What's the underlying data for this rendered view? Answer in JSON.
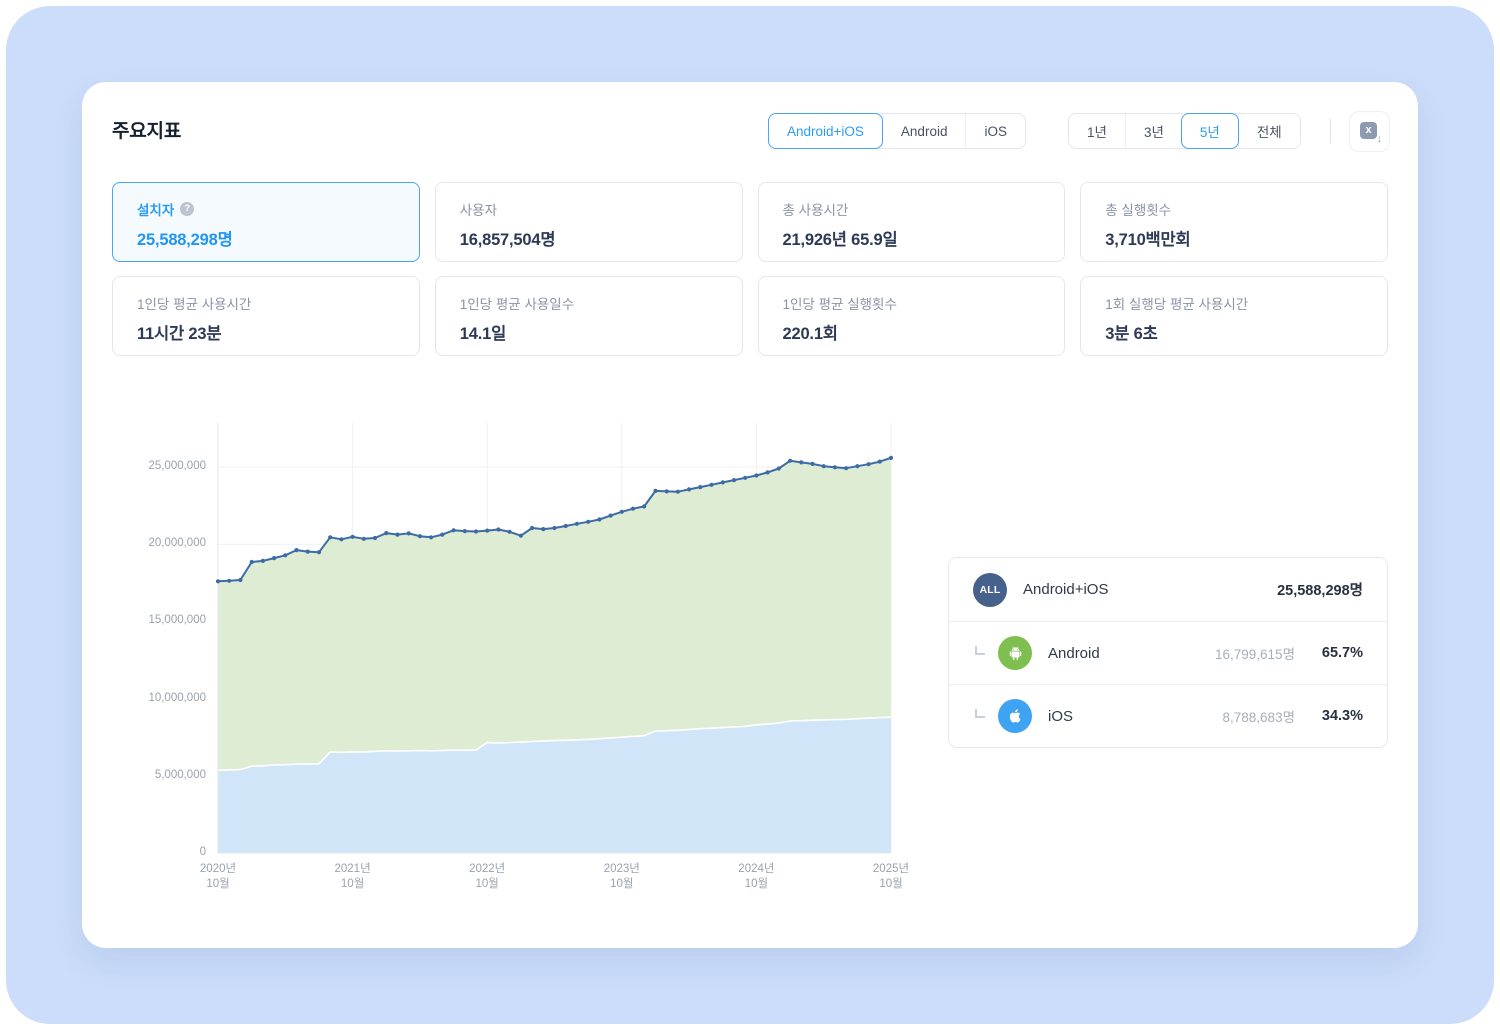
{
  "page": {
    "title": "주요지표"
  },
  "platform_tabs": {
    "items": [
      {
        "label": "Android+iOS",
        "selected": true
      },
      {
        "label": "Android",
        "selected": false
      },
      {
        "label": "iOS",
        "selected": false
      }
    ]
  },
  "range_tabs": {
    "items": [
      {
        "label": "1년",
        "selected": false
      },
      {
        "label": "3년",
        "selected": false
      },
      {
        "label": "5년",
        "selected": true
      },
      {
        "label": "전체",
        "selected": false
      }
    ]
  },
  "export_button": {
    "icon": "excel-download-icon",
    "icon_letter": "x",
    "icon_arrow": "↓"
  },
  "stat_cards": [
    {
      "label": "설치자",
      "value": "25,588,298명",
      "selected": true,
      "has_help_icon": true,
      "help_glyph": "?"
    },
    {
      "label": "사용자",
      "value": "16,857,504명"
    },
    {
      "label": "총 사용시간",
      "value": "21,926년 65.9일"
    },
    {
      "label": "총 실행횟수",
      "value": "3,710백만회"
    },
    {
      "label": "1인당 평균 사용시간",
      "value": "11시간 23분"
    },
    {
      "label": "1인당 평균 사용일수",
      "value": "14.1일"
    },
    {
      "label": "1인당 평균 실행횟수",
      "value": "220.1회"
    },
    {
      "label": "1회 실행당 평균 사용시간",
      "value": "3분 6초"
    }
  ],
  "legend": {
    "rows": [
      {
        "badge": "ALL",
        "name": "Android+iOS",
        "value": "25,588,298명"
      },
      {
        "icon": "android-icon",
        "name": "Android",
        "count": "16,799,615명",
        "percent": "65.7%"
      },
      {
        "icon": "apple-icon",
        "name": "iOS",
        "count": "8,788,683명",
        "percent": "34.3%"
      }
    ]
  },
  "colors": {
    "accent_blue": "#2b9bf3",
    "selected_border": "#49a5f6",
    "total_line": "#3c6ba5",
    "ios_area_fill": "#cde4f7",
    "android_area_fill": "#dbead0",
    "android_icon_green": "#7fbf50",
    "ios_icon_blue": "#3ea3f2",
    "all_badge_navy": "#45618c",
    "page_background": "#cbddfa"
  },
  "chart_data": {
    "type": "area",
    "x_range": [
      "2020-10",
      "2025-10"
    ],
    "granularity": "monthly",
    "points": 61,
    "grid": true,
    "legend_position": "right-panel",
    "ylim": [
      0,
      27000000
    ],
    "y_ticks": [
      {
        "label": "0",
        "value": 0
      },
      {
        "label": "5,000,000",
        "value": 5
      },
      {
        "label": "10,000,000",
        "value": 10
      },
      {
        "label": "15,000,000",
        "value": 15
      },
      {
        "label": "20,000,000",
        "value": 20
      },
      {
        "label": "25,000,000",
        "value": 25
      }
    ],
    "x_ticks": [
      {
        "line1": "2020년",
        "line2": "10월",
        "m": 0
      },
      {
        "line1": "2021년",
        "line2": "10월",
        "m": 12
      },
      {
        "line1": "2022년",
        "line2": "10월",
        "m": 24
      },
      {
        "line1": "2023년",
        "line2": "10월",
        "m": 36
      },
      {
        "line1": "2024년",
        "line2": "10월",
        "m": 48
      },
      {
        "line1": "2025년",
        "line2": "10월",
        "m": 60
      }
    ],
    "series": [
      {
        "name": "iOS",
        "type": "area",
        "color": "#cde4f7",
        "values": [
          5350000,
          5380000,
          5400000,
          5620000,
          5650000,
          5700000,
          5720000,
          5750000,
          5760000,
          5780000,
          6550000,
          6520000,
          6550000,
          6550000,
          6580000,
          6620000,
          6600000,
          6620000,
          6630000,
          6620000,
          6640000,
          6660000,
          6650000,
          6670000,
          7150000,
          7120000,
          7150000,
          7180000,
          7220000,
          7250000,
          7280000,
          7300000,
          7330000,
          7360000,
          7400000,
          7450000,
          7500000,
          7550000,
          7600000,
          7900000,
          7920000,
          7950000,
          8000000,
          8050000,
          8080000,
          8120000,
          8160000,
          8200000,
          8300000,
          8350000,
          8420000,
          8550000,
          8570000,
          8600000,
          8620000,
          8640000,
          8660000,
          8700000,
          8740000,
          8770000,
          8788683
        ]
      },
      {
        "name": "Android",
        "type": "area-stacked",
        "color": "#dbead0",
        "values": [
          12250000,
          12250000,
          12280000,
          13230000,
          13270000,
          13400000,
          13560000,
          13870000,
          13760000,
          13700000,
          13900000,
          13800000,
          13930000,
          13800000,
          13820000,
          14100000,
          14020000,
          14080000,
          13890000,
          13830000,
          13980000,
          14240000,
          14200000,
          14150000,
          13730000,
          13830000,
          13650000,
          13370000,
          13830000,
          13730000,
          13770000,
          13880000,
          13990000,
          14090000,
          14200000,
          14400000,
          14600000,
          14750000,
          14850000,
          15550000,
          15500000,
          15450000,
          15550000,
          15650000,
          15770000,
          15880000,
          15990000,
          16100000,
          16150000,
          16300000,
          16480000,
          16850000,
          16730000,
          16600000,
          16430000,
          16340000,
          16260000,
          16350000,
          16440000,
          16580000,
          16799615
        ]
      },
      {
        "name": "Android+iOS",
        "type": "line",
        "color": "#3c6ba5",
        "markers": true,
        "values": [
          17600000,
          17630000,
          17680000,
          18850000,
          18920000,
          19100000,
          19280000,
          19620000,
          19520000,
          19480000,
          20450000,
          20320000,
          20480000,
          20350000,
          20400000,
          20720000,
          20620000,
          20700000,
          20520000,
          20450000,
          20620000,
          20900000,
          20850000,
          20820000,
          20880000,
          20950000,
          20800000,
          20550000,
          21050000,
          20980000,
          21050000,
          21180000,
          21320000,
          21450000,
          21600000,
          21850000,
          22100000,
          22300000,
          22450000,
          23450000,
          23420000,
          23400000,
          23550000,
          23700000,
          23850000,
          24000000,
          24150000,
          24300000,
          24450000,
          24650000,
          24900000,
          25400000,
          25300000,
          25200000,
          25050000,
          24980000,
          24920000,
          25050000,
          25180000,
          25350000,
          25588298
        ]
      }
    ]
  }
}
